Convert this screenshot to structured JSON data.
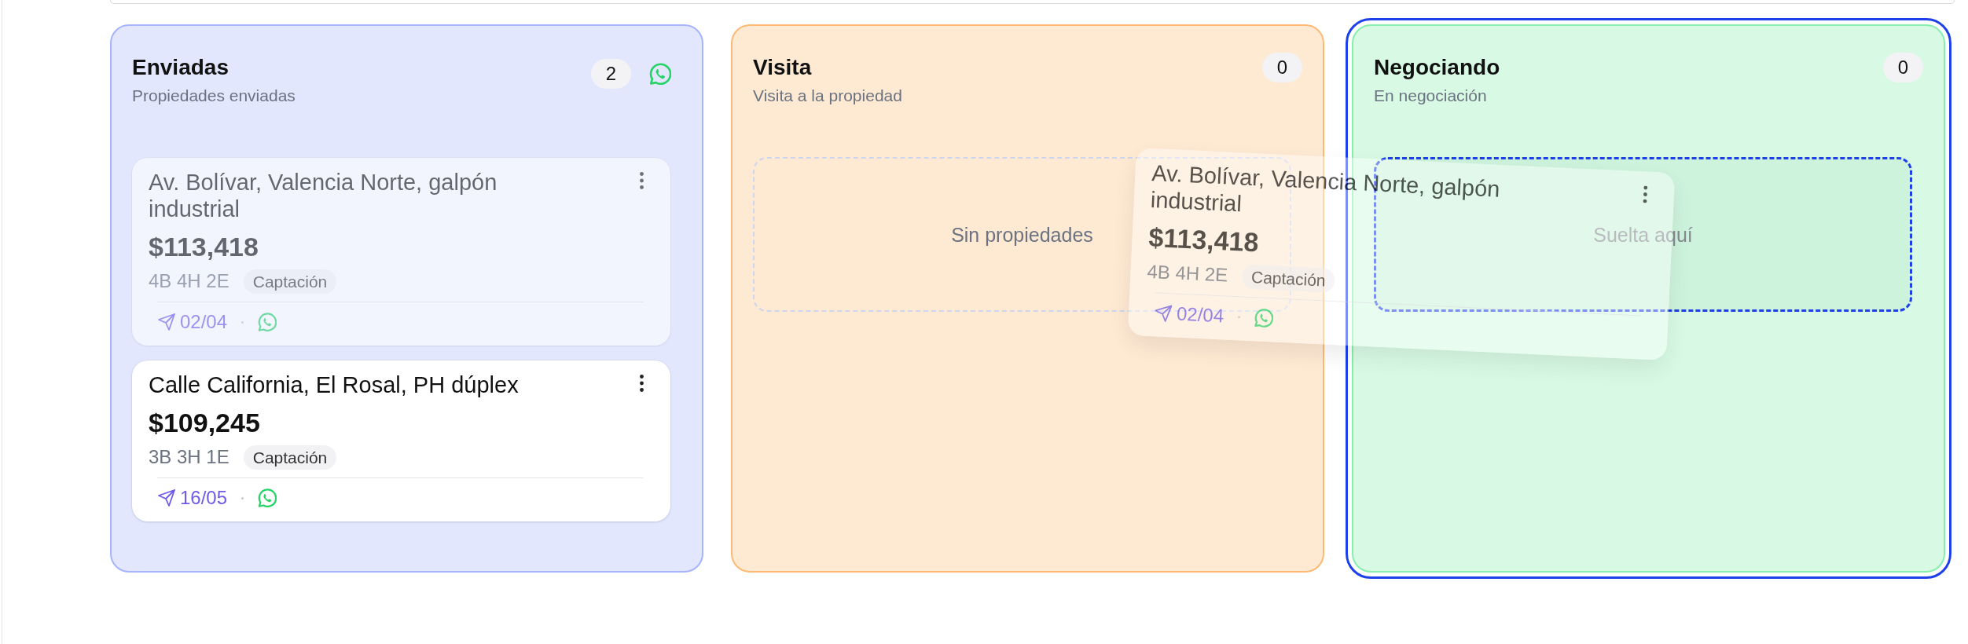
{
  "columns": [
    {
      "title": "Enviadas",
      "subtitle": "Propiedades enviadas",
      "count": "2",
      "whatsapp_button": true,
      "color": "#a5b4fc",
      "drop_target": false,
      "cards": [
        {
          "title": "Av. Bolívar, Valencia Norte, galpón industrial",
          "price": "$113,418",
          "specs": "4B 4H 2E",
          "tag": "Captación",
          "date": "02/04",
          "dragging": true
        },
        {
          "title": "Calle California, El Rosal, PH dúplex",
          "price": "$109,245",
          "specs": "3B 3H 1E",
          "tag": "Captación",
          "date": "16/05",
          "dragging": false
        }
      ]
    },
    {
      "title": "Visita",
      "subtitle": "Visita a la propiedad",
      "count": "0",
      "whatsapp_button": false,
      "color": "#fdba74",
      "drop_target": false,
      "empty_text": "Sin propiedades"
    },
    {
      "title": "Negociando",
      "subtitle": "En negociación",
      "count": "0",
      "whatsapp_button": false,
      "color": "#86efac",
      "drop_target": true,
      "empty_text": "Suelta aquí"
    }
  ],
  "drag_preview": {
    "title": "Av. Bolívar, Valencia Norte, galpón industrial",
    "price": "$113,418",
    "specs": "4B 4H 2E",
    "tag": "Captación",
    "date": "02/04"
  }
}
